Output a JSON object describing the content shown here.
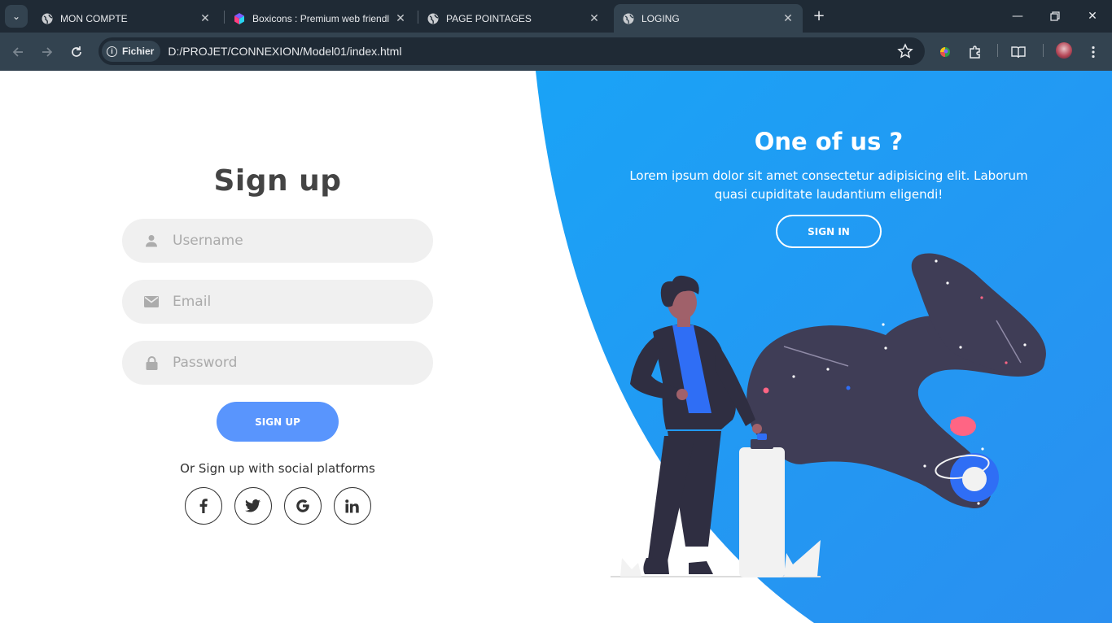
{
  "browser": {
    "tabs": [
      {
        "title": "MON COMPTE",
        "favicon": "globe-icon"
      },
      {
        "title": "Boxicons : Premium web friendl",
        "favicon": "boxicons-logo-icon"
      },
      {
        "title": "PAGE POINTAGES",
        "favicon": "globe-icon"
      },
      {
        "title": "LOGING",
        "favicon": "globe-icon",
        "active": true
      }
    ],
    "address": {
      "security_chip": "Fichier",
      "url": "D:/PROJET/CONNEXION/Model01/index.html"
    }
  },
  "signup": {
    "title": "Sign up",
    "username_placeholder": "Username",
    "email_placeholder": "Email",
    "password_placeholder": "Password",
    "submit_label": "SIGN UP",
    "social_text": "Or Sign up with social platforms",
    "socials": [
      {
        "name": "facebook",
        "glyph": "f"
      },
      {
        "name": "twitter",
        "glyph": "t"
      },
      {
        "name": "google",
        "glyph": "G"
      },
      {
        "name": "linkedin",
        "glyph": "in"
      }
    ]
  },
  "panel": {
    "title": "One of us ?",
    "text": "Lorem ipsum dolor sit amet consectetur adipisicing elit. Laborum quasi cupiditate laudantium eligendi!",
    "signin_label": "SIGN IN"
  },
  "colors": {
    "accent": "#5995fd",
    "panel_blue": "#1da1f5",
    "chrome_dark": "#1f2a35",
    "chrome_mid": "#334350"
  }
}
